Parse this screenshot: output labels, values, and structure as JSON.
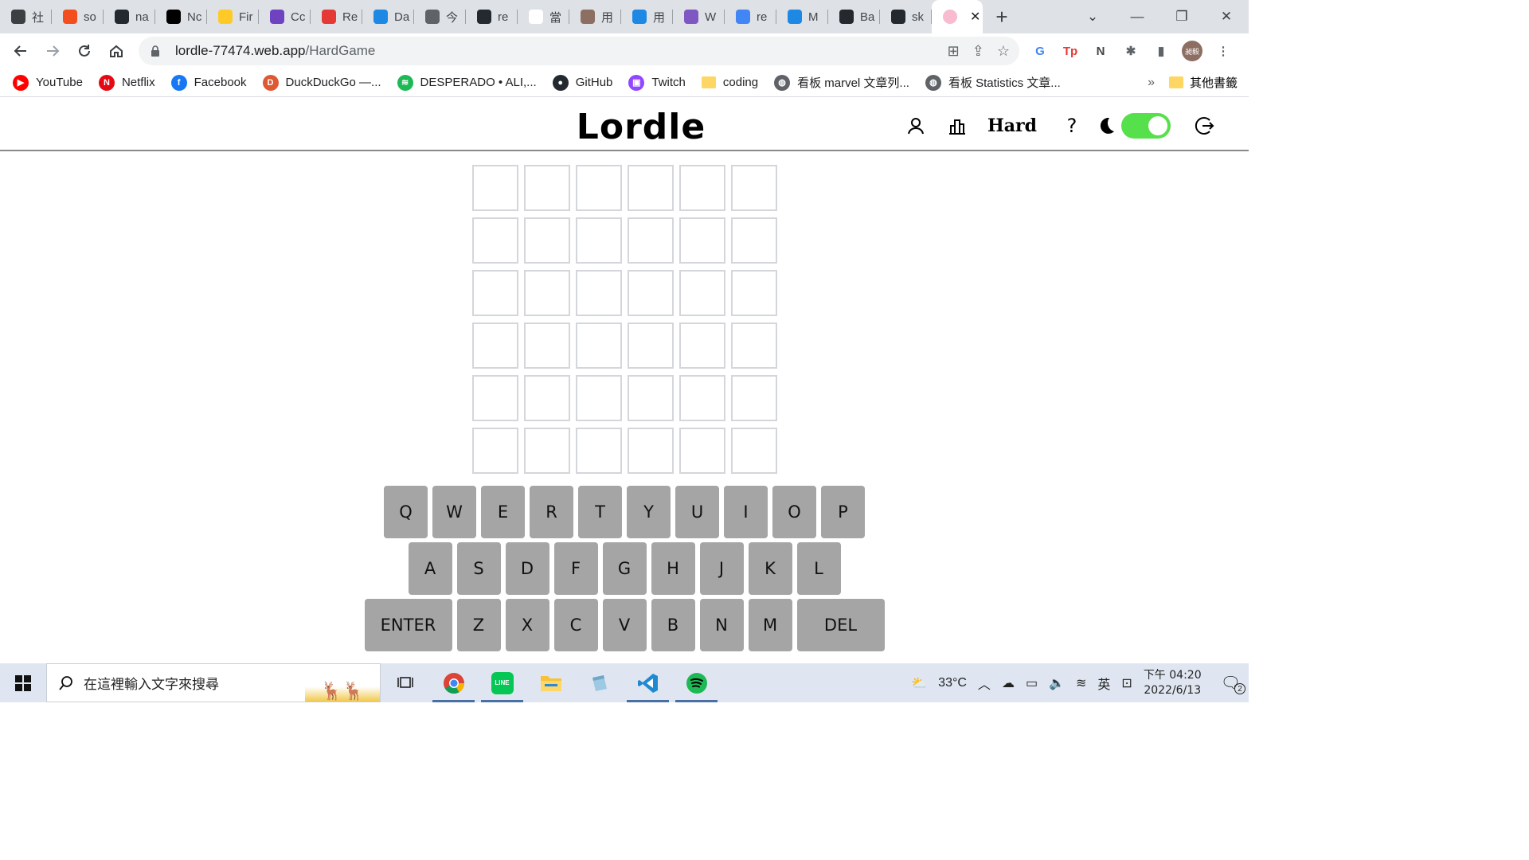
{
  "browser": {
    "tabs": [
      {
        "label": "社",
        "icon": "feather-icon",
        "color": "#3c4043"
      },
      {
        "label": "so",
        "icon": "figma-icon",
        "color": "#f24e1e"
      },
      {
        "label": "na",
        "icon": "github-icon",
        "color": "#24292f"
      },
      {
        "label": "Nc",
        "icon": "notion-icon",
        "color": "#000000"
      },
      {
        "label": "Fir",
        "icon": "firebase-icon",
        "color": "#ffca28"
      },
      {
        "label": "Cc",
        "icon": "rocket-icon",
        "color": "#6f42c1"
      },
      {
        "label": "Re",
        "icon": "dots-icon",
        "color": "#e53935"
      },
      {
        "label": "Da",
        "icon": "web-icon",
        "color": "#1e88e5"
      },
      {
        "label": "今",
        "icon": "globe-icon",
        "color": "#5f6368"
      },
      {
        "label": "re",
        "icon": "github-icon",
        "color": "#24292f"
      },
      {
        "label": "當",
        "icon": "tb-icon",
        "color": "#ffffff"
      },
      {
        "label": "用",
        "icon": "photo-icon",
        "color": "#8d6e63"
      },
      {
        "label": "用",
        "icon": "web-icon",
        "color": "#1e88e5"
      },
      {
        "label": "W",
        "icon": "openai-icon",
        "color": "#7e57c2"
      },
      {
        "label": "re",
        "icon": "google-icon",
        "color": "#4285f4"
      },
      {
        "label": "M",
        "icon": "web-icon",
        "color": "#1e88e5"
      },
      {
        "label": "Ba",
        "icon": "github-icon",
        "color": "#24292f"
      },
      {
        "label": "sk",
        "icon": "github-icon",
        "color": "#24292f"
      }
    ],
    "active_tab_icon": "brain-icon",
    "url_host": "lordle-77474.web.app",
    "url_path": "/HardGame",
    "bookmarks": [
      {
        "label": "YouTube",
        "icon": "youtube-icon",
        "color": "#ff0000",
        "glyph": "▶"
      },
      {
        "label": "Netflix",
        "icon": "netflix-icon",
        "color": "#e50914",
        "glyph": "N"
      },
      {
        "label": "Facebook",
        "icon": "facebook-icon",
        "color": "#1877f2",
        "glyph": "f"
      },
      {
        "label": "DuckDuckGo —...",
        "icon": "duckduckgo-icon",
        "color": "#de5833",
        "glyph": "D"
      },
      {
        "label": "DESPERADO • ALI,...",
        "icon": "spotify-icon",
        "color": "#1db954",
        "glyph": "≋"
      },
      {
        "label": "GitHub",
        "icon": "github-icon",
        "color": "#24292f",
        "glyph": "●"
      },
      {
        "label": "Twitch",
        "icon": "twitch-icon",
        "color": "#9146ff",
        "glyph": "▣"
      },
      {
        "label": "coding",
        "icon": "folder-icon",
        "color": "#fdd663",
        "glyph": ""
      },
      {
        "label": "看板 marvel 文章列...",
        "icon": "globe-icon",
        "color": "#5f6368",
        "glyph": "◍"
      },
      {
        "label": "看板 Statistics 文章...",
        "icon": "globe-icon",
        "color": "#5f6368",
        "glyph": "◍"
      }
    ],
    "bookmarks_more": "»",
    "other_bookmarks": "其他書籤",
    "profile_initials": "昶毅"
  },
  "app": {
    "title": "Lordle",
    "mode": "Hard",
    "help": "?",
    "dark_mode_on": true,
    "toggle_color": "#56e04b",
    "board": {
      "rows": 6,
      "cols": 6
    },
    "keyboard": {
      "row1": [
        "Q",
        "W",
        "E",
        "R",
        "T",
        "Y",
        "U",
        "I",
        "O",
        "P"
      ],
      "row2": [
        "A",
        "S",
        "D",
        "F",
        "G",
        "H",
        "J",
        "K",
        "L"
      ],
      "row3": [
        "ENTER",
        "Z",
        "X",
        "C",
        "V",
        "B",
        "N",
        "M",
        "DEL"
      ]
    },
    "key_color": "#a5a5a5"
  },
  "taskbar": {
    "search_placeholder": "在這裡輸入文字來搜尋",
    "weather": "33°C",
    "ime": "英",
    "time": "下午 04:20",
    "date": "2022/6/13",
    "notification_count": "2"
  }
}
